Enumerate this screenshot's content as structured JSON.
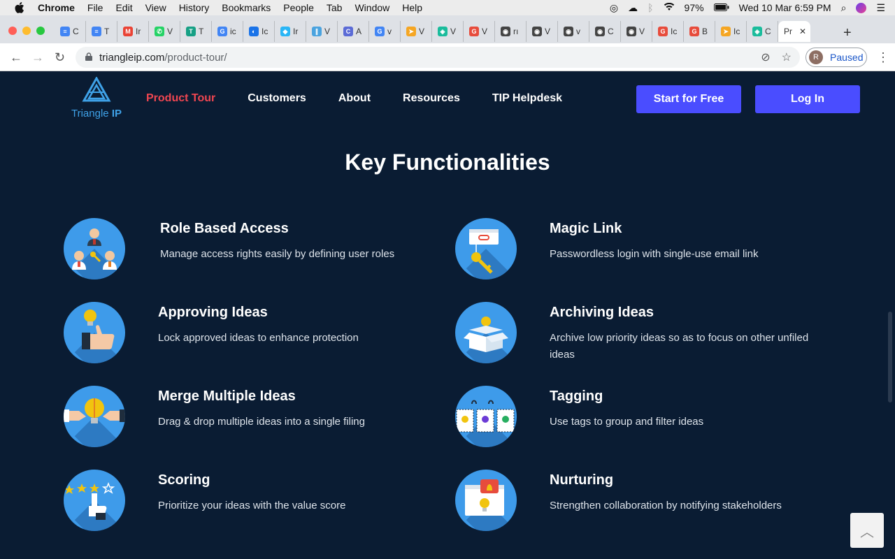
{
  "menubar": {
    "app": "Chrome",
    "items": [
      "File",
      "Edit",
      "View",
      "History",
      "Bookmarks",
      "People",
      "Tab",
      "Window",
      "Help"
    ],
    "battery": "97%",
    "clock": "Wed 10 Mar  6:59 PM"
  },
  "tabs": [
    {
      "label": "C",
      "color": "#4285f4",
      "glyph": "≡"
    },
    {
      "label": "T",
      "color": "#4285f4",
      "glyph": "≡"
    },
    {
      "label": "Ir",
      "color": "#ea4335",
      "glyph": "M"
    },
    {
      "label": "V",
      "color": "#25d366",
      "glyph": "✆"
    },
    {
      "label": "T",
      "color": "#16a085",
      "glyph": "T"
    },
    {
      "label": "ic",
      "color": "#4285f4",
      "glyph": "G"
    },
    {
      "label": "Ic",
      "color": "#1a73e8",
      "glyph": "◐"
    },
    {
      "label": "Ir",
      "color": "#29b6f6",
      "glyph": "◆"
    },
    {
      "label": "V",
      "color": "#4aa3df",
      "glyph": "∥"
    },
    {
      "label": "A",
      "color": "#5b6bd6",
      "glyph": "C"
    },
    {
      "label": "v",
      "color": "#4285f4",
      "glyph": "G"
    },
    {
      "label": "V",
      "color": "#f5a623",
      "glyph": "➤"
    },
    {
      "label": "V",
      "color": "#1abc9c",
      "glyph": "◈"
    },
    {
      "label": "V",
      "color": "#e74c3c",
      "glyph": "G"
    },
    {
      "label": "rı",
      "color": "#444444",
      "glyph": "◉"
    },
    {
      "label": "V",
      "color": "#444444",
      "glyph": "◉"
    },
    {
      "label": "v",
      "color": "#444444",
      "glyph": "◉"
    },
    {
      "label": "C",
      "color": "#444444",
      "glyph": "◉"
    },
    {
      "label": "V",
      "color": "#444444",
      "glyph": "◉"
    },
    {
      "label": "Ic",
      "color": "#e74c3c",
      "glyph": "G"
    },
    {
      "label": "B",
      "color": "#e74c3c",
      "glyph": "G"
    },
    {
      "label": "Ic",
      "color": "#f5a623",
      "glyph": "➤"
    },
    {
      "label": "C",
      "color": "#1abc9c",
      "glyph": "◈"
    }
  ],
  "active_tab": {
    "label": "Pr"
  },
  "address": {
    "host": "triangleip.com",
    "path": "/product-tour/"
  },
  "profile": {
    "initial": "R",
    "status": "Paused"
  },
  "site": {
    "logo_name_1": "Triangle ",
    "logo_name_2": "IP",
    "nav": [
      "Product Tour",
      "Customers",
      "About",
      "Resources",
      "TIP Helpdesk"
    ],
    "start_label": "Start for Free",
    "login_label": "Log In",
    "colors": {
      "bg": "#0a1c33",
      "accent": "#4a4dff",
      "active_nav": "#ef4651",
      "icon_bg": "#3e9bea"
    }
  },
  "section_title": "Key Functionalities",
  "features": [
    {
      "title": "Role Based Access",
      "desc": "Manage access rights easily by defining user roles",
      "icon": "users-key-icon"
    },
    {
      "title": "Magic Link",
      "desc": "Passwordless login with single-use email link",
      "icon": "magic-link-key-icon"
    },
    {
      "title": "Approving Ideas",
      "desc": "Lock approved ideas to enhance protection",
      "icon": "thumbs-up-bulb-icon"
    },
    {
      "title": "Archiving Ideas",
      "desc": "Archive low priority ideas so as to focus on other unfiled ideas",
      "icon": "archive-box-icon"
    },
    {
      "title": "Merge Multiple Ideas",
      "desc": "Drag & drop multiple ideas into a single filing",
      "icon": "puzzle-merge-icon"
    },
    {
      "title": "Tagging",
      "desc": "Use tags to group and filter ideas",
      "icon": "tags-icon"
    },
    {
      "title": "Scoring",
      "desc": "Prioritize your ideas with the value score",
      "icon": "star-rating-icon"
    },
    {
      "title": "Nurturing",
      "desc": "Strengthen collaboration by notifying stakeholders",
      "icon": "notification-bell-icon"
    }
  ]
}
